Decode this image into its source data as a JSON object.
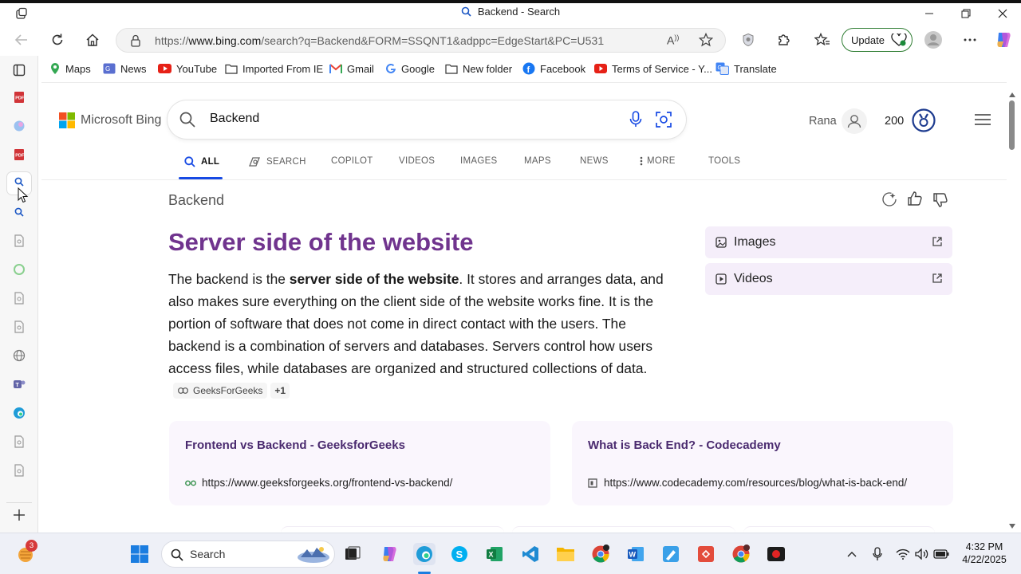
{
  "window": {
    "title": "Backend - Search"
  },
  "toolbar": {
    "url_prefix": "https://",
    "url_host": "www.bing.com",
    "url_path": "/search?q=Backend&FORM=SSQNT1&adppc=EdgeStart&PC=U531",
    "update_label": "Update"
  },
  "favorites": [
    "Maps",
    "News",
    "YouTube",
    "Imported From IE",
    "Gmail",
    "Google",
    "New folder",
    "Facebook",
    "Terms of Service - Y...",
    "Translate"
  ],
  "bing": {
    "logo_text": "Microsoft Bing",
    "query": "Backend",
    "user_name": "Rana",
    "points": "200",
    "nav": [
      "ALL",
      "SEARCH",
      "COPILOT",
      "VIDEOS",
      "IMAGES",
      "MAPS",
      "NEWS",
      "MORE",
      "TOOLS"
    ]
  },
  "answer": {
    "query_label": "Backend",
    "title": "Server side of the website",
    "body_1": "The backend is the ",
    "body_bold": "server side of the website",
    "body_2": ". It stores and arranges data, and also makes sure everything on the client side of the website works fine. It is the portion of software that does not come in direct contact with the users. The backend is a combination of servers and databases. Servers control how users access files, while databases are organized and structured collections of data.",
    "citation": "GeeksForGeeks",
    "citation_more": "+1"
  },
  "side_cards": [
    "Images",
    "Videos"
  ],
  "results": [
    {
      "title": "Frontend vs Backend - GeeksforGeeks",
      "url": "https://www.geeksforgeeks.org/frontend-vs-backend/"
    },
    {
      "title": "What is Back End? - Codecademy",
      "url": "https://www.codecademy.com/resources/blog/what-is-back-end/"
    }
  ],
  "taskbar": {
    "search_label": "Search",
    "badge": "3",
    "time": "4:32 PM",
    "date": "4/22/2025"
  },
  "colors": {
    "accent": "#174ae4",
    "answer_title": "#70348e",
    "result_title": "#4a2a6f"
  }
}
